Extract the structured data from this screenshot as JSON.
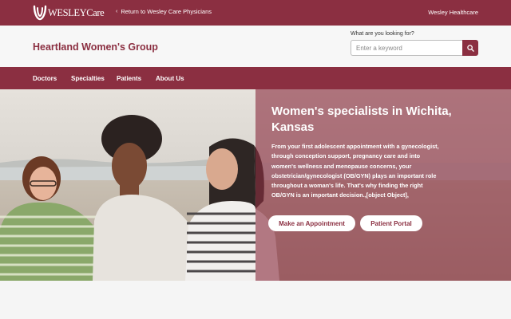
{
  "topbar": {
    "logo_text": "WESLEYCare",
    "return_label": "Return to Wesley Care Physicians",
    "health_label": "Wesley Healthcare"
  },
  "header": {
    "site_name": "Heartland Women's Group",
    "search": {
      "label": "What are you looking for?",
      "placeholder": "Enter a keyword",
      "button_icon": "search-icon"
    }
  },
  "nav": {
    "items": [
      {
        "label": "Doctors"
      },
      {
        "label": "Specialties"
      },
      {
        "label": "Patients"
      },
      {
        "label": "About Us"
      }
    ]
  },
  "hero": {
    "title": "Women's specialists in Wichita, Kansas",
    "body": "From your first adolescent appointment with a gynecologist, through conception support, pregnancy care and into women's wellness and menopause concerns, your obstetrician/gynecologist (OB/GYN) plays an important role throughout a woman's life. That's why finding the right OB/GYN is an important decision.,[object Object],",
    "buttons": {
      "appointment": "Make an Appointment",
      "portal": "Patient Portal"
    }
  },
  "colors": {
    "brand": "#8b2f41",
    "header_bg": "#f7f7f7",
    "button_text": "#8b2f41"
  }
}
